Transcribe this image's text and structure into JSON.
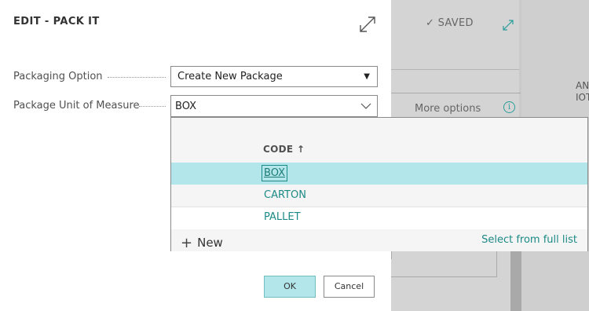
{
  "dialog": {
    "title": "EDIT - PACK IT",
    "expand_icon": "expand-icon"
  },
  "fields": {
    "packaging_option": {
      "label": "Packaging Option",
      "value": "Create New Package"
    },
    "package_uom": {
      "label": "Package Unit of Measure",
      "value": "BOX"
    }
  },
  "lookup": {
    "column_header": "CODE ↑",
    "rows": [
      {
        "code": "BOX",
        "selected": true
      },
      {
        "code": "CARTON",
        "selected": false
      },
      {
        "code": "PALLET",
        "selected": false
      }
    ],
    "new_label": "New",
    "full_list_label": "Select from full list"
  },
  "buttons": {
    "ok": "OK",
    "cancel": "Cancel"
  },
  "background": {
    "saved_label": "✓ SAVED",
    "more_options": "More options",
    "info_glyph": "i",
    "right_col_text": "AN\nIOT"
  },
  "colors": {
    "accent": "#1c8a86",
    "selected_row": "#b3e6ea"
  }
}
